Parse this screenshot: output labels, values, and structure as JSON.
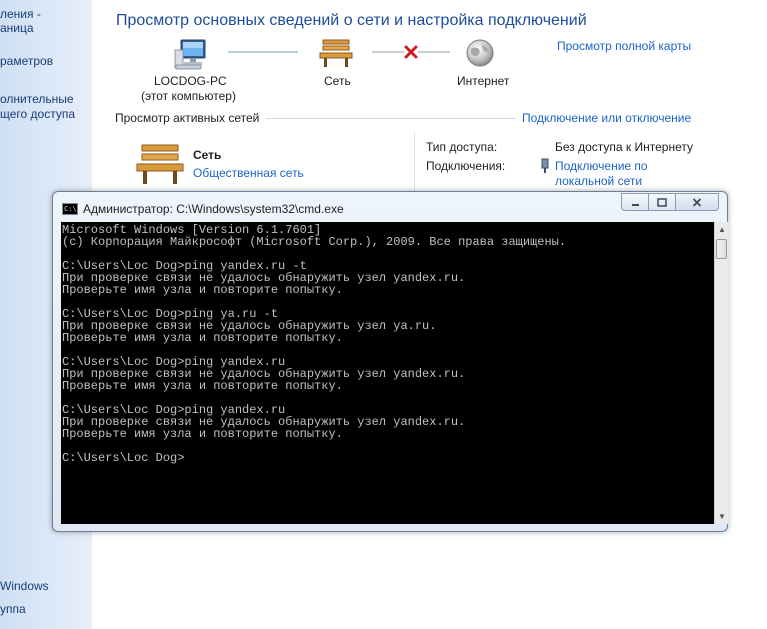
{
  "sidebar": {
    "items": [
      {
        "label": "ления -"
      },
      {
        "label": "аница"
      },
      {
        "label": "раметров"
      },
      {
        "label": "олнительные"
      },
      {
        "label": "щего доступа"
      },
      {
        "label": "Windows"
      },
      {
        "label": "уппа"
      }
    ]
  },
  "header": {
    "title": "Просмотр основных сведений о сети и настройка подключений",
    "full_map_link": "Просмотр полной карты"
  },
  "network_map": {
    "computer": {
      "name": "LOCDOG-PC",
      "sub": "(этот компьютер)",
      "icon": "computer-icon"
    },
    "network": {
      "name": "Сеть",
      "icon": "bench-icon"
    },
    "internet": {
      "name": "Интернет",
      "icon": "globe-icon"
    },
    "status_icon": "red-x-icon"
  },
  "active_networks": {
    "header": "Просмотр активных сетей",
    "connect_link": "Подключение или отключение",
    "network_name": "Сеть",
    "network_type": "Общественная сеть",
    "access_label": "Тип доступа:",
    "access_value": "Без доступа к Интернету",
    "connections_label": "Подключения:",
    "connections_value_line1": "Подключение по",
    "connections_value_line2": "локальной сети",
    "colors": {
      "link": "#1b64c8",
      "title": "#1c4d9a"
    }
  },
  "cmd": {
    "title": "Администратор: C:\\Windows\\system32\\cmd.exe",
    "icon_text": "C:\\",
    "lines": [
      "Microsoft Windows [Version 6.1.7601]",
      "(c) Корпорация Майкрософт (Microsoft Corp.), 2009. Все права защищены.",
      "",
      "C:\\Users\\Loc Dog>ping yandex.ru -t",
      "При проверке связи не удалось обнаружить узел yandex.ru.",
      "Проверьте имя узла и повторите попытку.",
      "",
      "C:\\Users\\Loc Dog>ping ya.ru -t",
      "При проверке связи не удалось обнаружить узел ya.ru.",
      "Проверьте имя узла и повторите попытку.",
      "",
      "C:\\Users\\Loc Dog>ping yandex.ru",
      "При проверке связи не удалось обнаружить узел yandex.ru.",
      "Проверьте имя узла и повторите попытку.",
      "",
      "C:\\Users\\Loc Dog>ping yandex.ru",
      "При проверке связи не удалось обнаружить узел yandex.ru.",
      "Проверьте имя узла и повторите попытку.",
      "",
      "C:\\Users\\Loc Dog>"
    ],
    "buttons": {
      "minimize": "minimize-icon",
      "maximize": "maximize-icon",
      "close": "close-icon"
    }
  }
}
